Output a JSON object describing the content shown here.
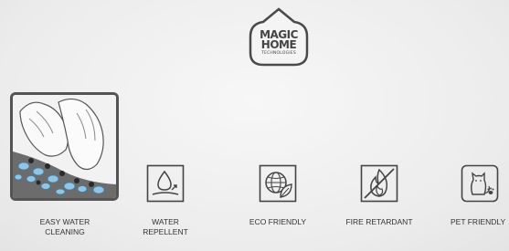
{
  "logo": {
    "line1": "MAGIC",
    "line2": "HOME",
    "line3": "TECHNOLOGIES"
  },
  "features": [
    {
      "icon": "hands-cleaning-fabric-photo",
      "label_line1": "EASY WATER",
      "label_line2": "CLEANING"
    },
    {
      "icon": "water-repellent-icon",
      "label_line1": "WATER",
      "label_line2": "REPELLENT"
    },
    {
      "icon": "eco-globe-leaf-icon",
      "label": "ECO FRIENDLY"
    },
    {
      "icon": "fire-retardant-icon",
      "label": "FIRE RETARDANT"
    },
    {
      "icon": "pet-friendly-icon",
      "label": "PET FRIENDLY"
    }
  ],
  "colors": {
    "icon_stroke": "#444444",
    "frame": "#545454",
    "text": "#333333"
  }
}
